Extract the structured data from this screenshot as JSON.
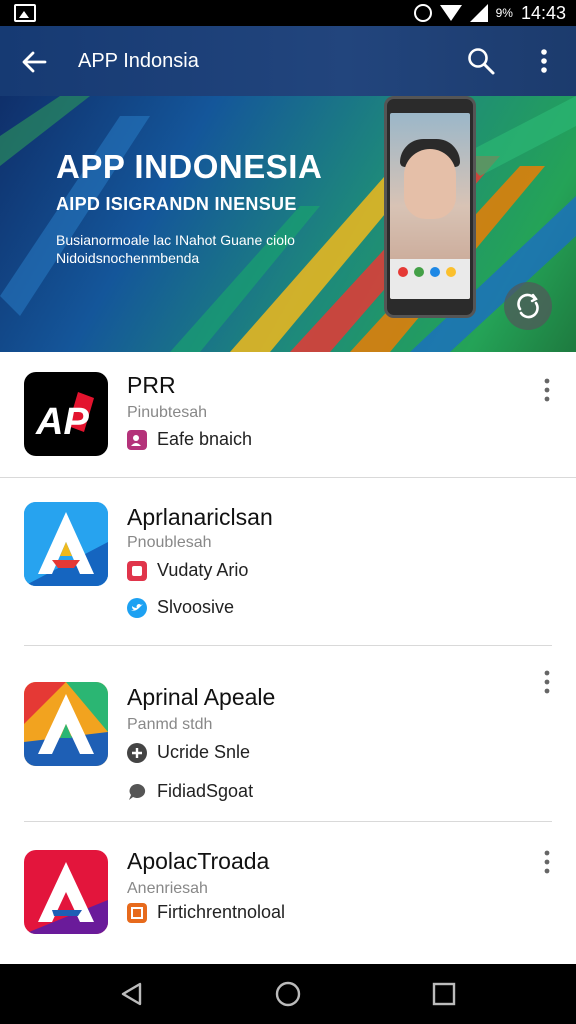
{
  "status_bar": {
    "battery_percent": "9%",
    "time": "14:43"
  },
  "app_bar": {
    "title": "APP Indonsia",
    "icons": [
      "back-arrow-icon",
      "search-icon",
      "more-vert-icon"
    ]
  },
  "banner": {
    "headline": "APP INDONESIA",
    "subheadline": "AIPD ISIGRANDN INENSUE",
    "line1": "Busianormoale lac INahot Guane ciolo",
    "line2": "Nidoidsnochenmbenda",
    "colors": {
      "bg_from": "#0f2f6a",
      "bg_to": "#24a357"
    }
  },
  "apps": [
    {
      "name": "PRR",
      "subtitle": "Pinubtesah",
      "icon_bg": "#000000",
      "details": [
        {
          "icon": "profile-badge-icon",
          "color": "#b4327a",
          "text": "Eafe bnaich"
        }
      ]
    },
    {
      "name": "Aprlanariclsan",
      "subtitle": "Pnoublesah",
      "icon_bg": "#1e8fe0",
      "details": [
        {
          "icon": "red-square-icon",
          "color": "#e0354b",
          "text": "Vudaty Ario"
        },
        {
          "icon": "twitter-bird-icon",
          "color": "#1da1f2",
          "text": "Slvoosive"
        }
      ]
    },
    {
      "name": "Aprinal Apeale",
      "subtitle": "Panmd stdh",
      "icon_bg": "#f2a31f",
      "details": [
        {
          "icon": "plus-circle-icon",
          "color": "#444444",
          "text": "Ucride Snle"
        },
        {
          "icon": "chat-bubble-icon",
          "color": "#555555",
          "text": "FidiadSgoat"
        }
      ]
    },
    {
      "name": "ApolacTroada",
      "subtitle": "Anenriesah",
      "icon_bg": "#e3153c",
      "details": [
        {
          "icon": "orange-tag-icon",
          "color": "#e76a1c",
          "text": "Firtichrentnoloal"
        }
      ]
    }
  ],
  "nav_bar": {
    "icons": [
      "back-triangle-icon",
      "home-circle-icon",
      "recents-square-icon"
    ]
  }
}
